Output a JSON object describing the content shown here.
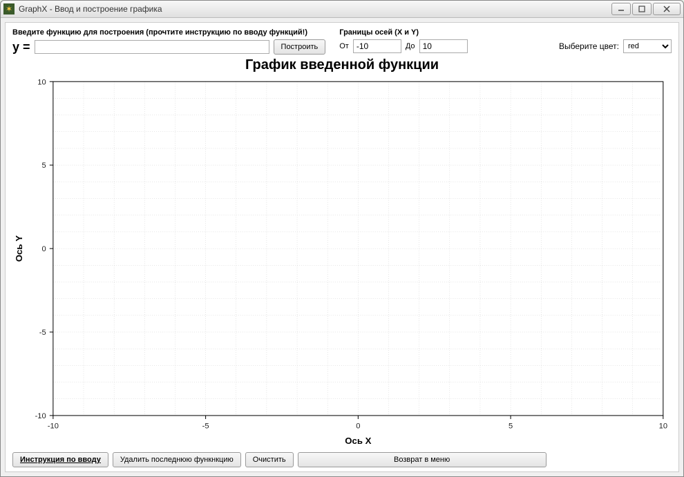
{
  "window": {
    "title": "GraphX  -  Ввод и построение графика"
  },
  "func": {
    "label": "Введите функцию для построения  (прочтите инструкцию по вводу функций!)",
    "prefix": "y =",
    "value": "",
    "build_btn": "Построить"
  },
  "axes": {
    "label": "Границы осей (X и Y)",
    "from_label": "От",
    "from_value": "-10",
    "to_label": "До",
    "to_value": "10"
  },
  "color": {
    "label": "Выберите цвет:",
    "value": "red"
  },
  "chart": {
    "title": "График введенной функции"
  },
  "buttons": {
    "instructions": "Инструкция по вводу",
    "delete_last": "Удалить последнюю функнкцию",
    "clear": "Очистить",
    "back_menu": "Возврат в меню"
  },
  "chart_data": {
    "type": "line",
    "series": [],
    "xlabel": "Ось X",
    "ylabel": "Ось Y",
    "xlim": [
      -10,
      10
    ],
    "ylim": [
      -10,
      10
    ],
    "xticks": [
      -10,
      -5,
      0,
      5,
      10
    ],
    "yticks": [
      -10,
      -5,
      0,
      5,
      10
    ],
    "grid": true
  }
}
